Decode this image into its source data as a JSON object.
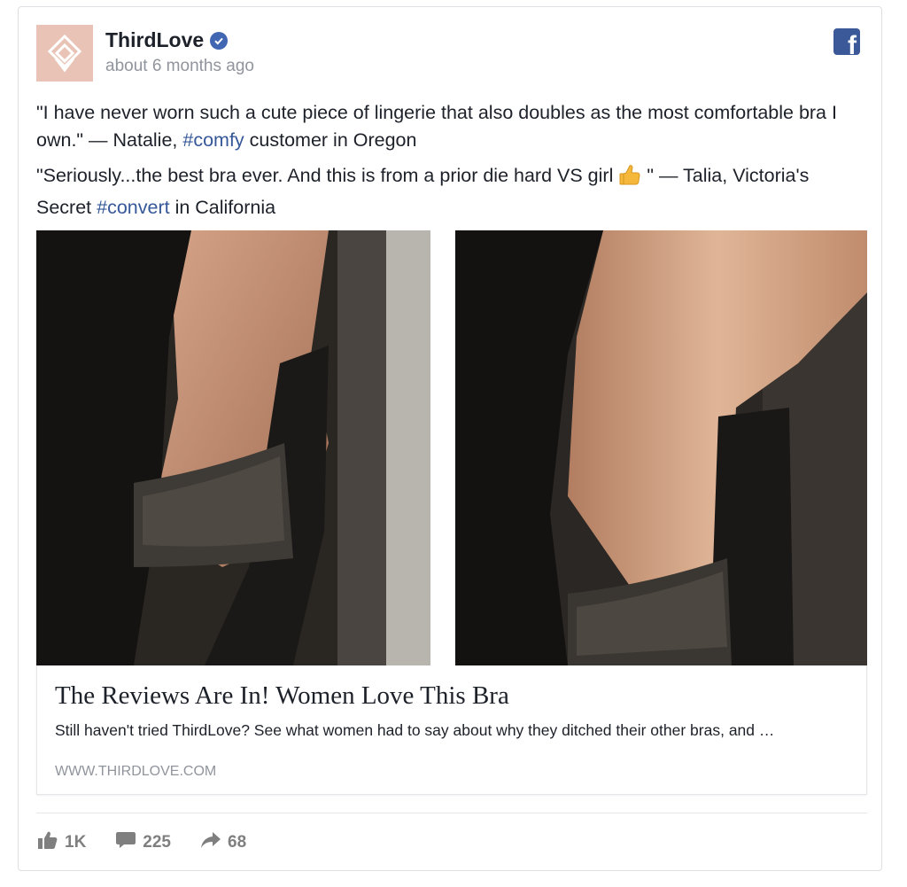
{
  "post": {
    "page_name": "ThirdLove",
    "timestamp": "about 6 months ago",
    "paragraph1": {
      "text_a": "\"I have never worn such a cute piece of lingerie that also doubles as the most comfortable bra I own.\" — Natalie, ",
      "hashtag": "#comfy",
      "text_b": " customer in Oregon"
    },
    "paragraph2": {
      "text_a": "\"Seriously...the best bra ever. And this is from a prior die hard VS girl",
      "text_b": "\" — Talia, Victoria's Secret ",
      "hashtag": "#convert",
      "text_c": " in California"
    }
  },
  "link": {
    "title": "The Reviews Are In! Women Love This Bra",
    "description": "Still haven't tried ThirdLove? See what women had to say about why they ditched their other bras, and …",
    "domain": "WWW.THIRDLOVE.COM"
  },
  "stats": {
    "likes": "1K",
    "comments": "225",
    "shares": "68"
  },
  "icons": {
    "verified": "verified-badge-icon",
    "facebook": "facebook-logo-icon",
    "like": "thumbs-up-icon",
    "comment": "comment-bubble-icon",
    "share": "share-arrow-icon",
    "emoji": "thumbs-up-emoji-icon"
  },
  "colors": {
    "avatar_bg": "#e9c3b5",
    "hashtag": "#365899",
    "verified": "#4267b2",
    "facebook_brand": "#3b5998",
    "muted_text": "#90949c"
  }
}
